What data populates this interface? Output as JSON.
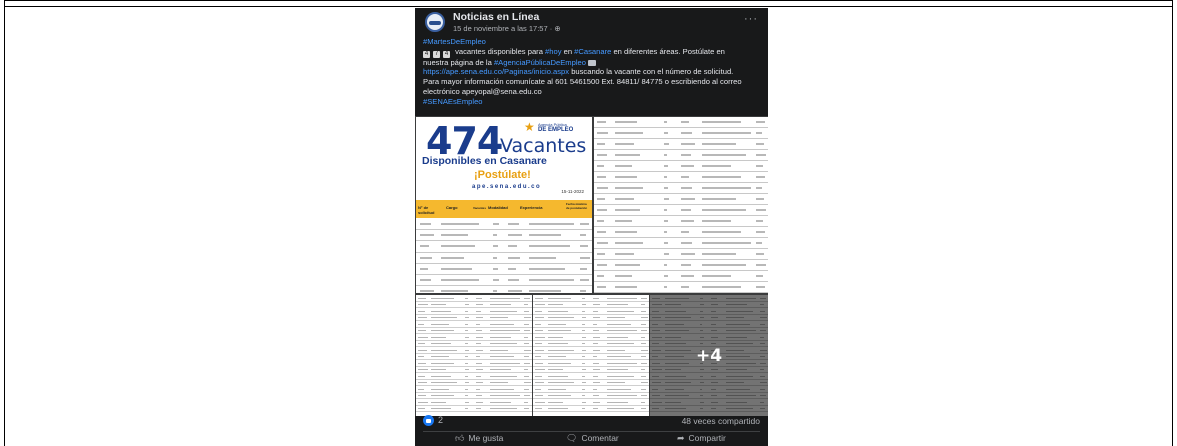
{
  "post": {
    "page_name": "Noticias en Línea",
    "time": "15 de noviembre a las 17:57 · ",
    "globe_icon": "globe-icon",
    "more": "···",
    "text": {
      "hashtag1": "#MartesDeEmpleo",
      "l2_digits": "474",
      "l2_a": " vacantes disponibles para ",
      "l2_hoy": "#hoy",
      "l2_b": " en ",
      "l2_casanare": "#Casanare",
      "l2_c": " en diferentes áreas. Postúlate en",
      "l3_a": "nuestra página de la ",
      "l3_agency": "#AgenciaPúblicaDeEmpleo",
      "l4_url": "https://ape.sena.edu.co/Paginas/inicio.aspx",
      "l4_b": " buscando la vacante con el número de solicitud.",
      "l5": "Para mayor información comunícate al 601 5461500 Ext. 84811/ 84775 o escribiendo al correo",
      "l6": "electrónico apeyopal@sena.edu.co",
      "hashtag2": "#SENAEsEmpleo"
    },
    "flyer": {
      "number": "474",
      "vacantes": "Vacantes",
      "disponibles": "Disponibles en Casanare",
      "postulate": "¡Postúlate!",
      "site": "ape.sena.edu.co",
      "date": "15-11-2022",
      "agency_line1": "Agencia Pública",
      "agency_line2": "DE EMPLEO",
      "col1": "N° de solicitud",
      "col2": "Cargo",
      "col3": "Vacantes",
      "col4": "Modalidad",
      "col5": "Experiencia",
      "col6": "Fecha máxima de postulación"
    },
    "more_photos": "+4",
    "reactions_count": "2",
    "shares": "48 veces compartido",
    "actions": {
      "like": "Me gusta",
      "comment": "Comentar",
      "share": "Compartir"
    }
  }
}
